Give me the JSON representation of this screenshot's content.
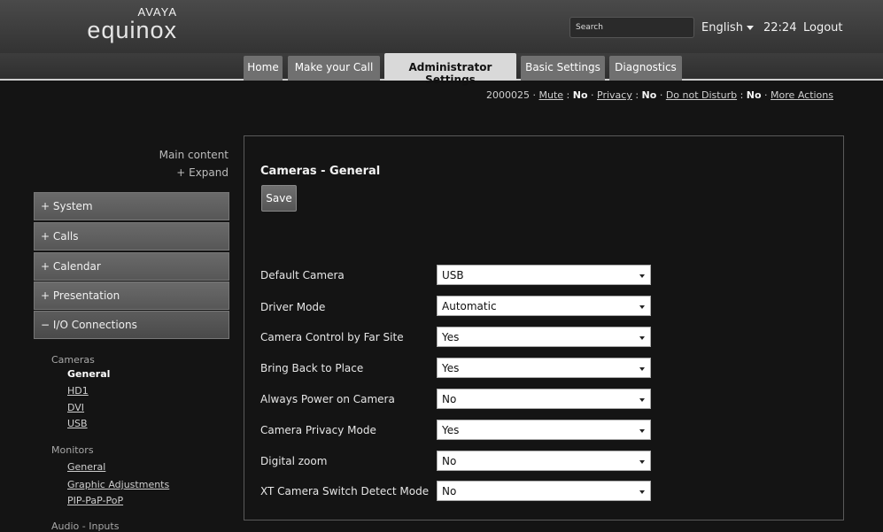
{
  "header": {
    "brand": "AVAYA",
    "product": "equinox",
    "search_placeholder": "Search",
    "language": "English",
    "time": "22:24",
    "logout": "Logout"
  },
  "tabs": [
    {
      "label": "Home"
    },
    {
      "label": "Make your Call"
    },
    {
      "label": "Administrator Settings",
      "active": true
    },
    {
      "label": "Basic Settings"
    },
    {
      "label": "Diagnostics"
    }
  ],
  "status": {
    "extension": "2000025",
    "sep": "·",
    "mute_label": "Mute",
    "mute_value": "No",
    "privacy_label": "Privacy",
    "privacy_value": "No",
    "dnd_label": "Do not Disturb",
    "dnd_value": "No",
    "more": "More Actions"
  },
  "sidebar": {
    "main_content": "Main content",
    "expand": "+ Expand",
    "items": [
      {
        "label": "+ System"
      },
      {
        "label": "+ Calls"
      },
      {
        "label": "+ Calendar"
      },
      {
        "label": "+ Presentation"
      },
      {
        "label": "− I/O Connections"
      }
    ],
    "cameras_head": "Cameras",
    "cameras_links": [
      "General",
      "HD1",
      "DVI",
      "USB"
    ],
    "monitors_head": "Monitors",
    "monitors_links": [
      "General",
      "Graphic Adjustments",
      "PIP-PaP-PoP"
    ],
    "audio_head": "Audio - Inputs"
  },
  "panel": {
    "title": "Cameras - General",
    "save_label": "Save",
    "rows": [
      {
        "label": "Default Camera",
        "value": "USB"
      },
      {
        "label": "Driver Mode",
        "value": "Automatic"
      },
      {
        "label": "Camera Control by Far Site",
        "value": "Yes"
      },
      {
        "label": "Bring Back to Place",
        "value": "Yes"
      },
      {
        "label": "Always Power on Camera",
        "value": "No"
      },
      {
        "label": "Camera Privacy Mode",
        "value": "Yes"
      },
      {
        "label": "Digital zoom",
        "value": "No"
      },
      {
        "label": "XT Camera Switch Detect Mode",
        "value": "No"
      }
    ]
  }
}
